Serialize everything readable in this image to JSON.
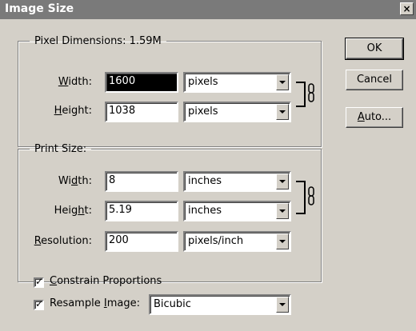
{
  "window": {
    "title": "Image Size",
    "close": "×"
  },
  "pixel_dimensions": {
    "legend": "Pixel Dimensions: 1.59M",
    "width": {
      "label_pre": "",
      "label_ul": "W",
      "label_post": "idth:",
      "value": "1600",
      "unit": "pixels"
    },
    "height": {
      "label_pre": "",
      "label_ul": "H",
      "label_post": "eight:",
      "value": "1038",
      "unit": "pixels"
    }
  },
  "print_size": {
    "legend": "Print Size:",
    "width": {
      "label_pre": "Wi",
      "label_ul": "d",
      "label_post": "th:",
      "value": "8",
      "unit": "inches"
    },
    "height": {
      "label_pre": "Heig",
      "label_ul": "h",
      "label_post": "t:",
      "value": "5.19",
      "unit": "inches"
    },
    "resolution": {
      "label_pre": "",
      "label_ul": "R",
      "label_post": "esolution:",
      "value": "200",
      "unit": "pixels/inch"
    }
  },
  "options": {
    "constrain": {
      "label_ul": "C",
      "label_post": "onstrain Proportions",
      "checked": true
    },
    "resample": {
      "label_pre": "Resample ",
      "label_ul": "I",
      "label_post": "mage:",
      "checked": true,
      "method": "Bicubic"
    }
  },
  "buttons": {
    "ok": "OK",
    "cancel": "Cancel",
    "auto_ul": "A",
    "auto_post": "uto..."
  },
  "link_icon": "chain-link-icon"
}
